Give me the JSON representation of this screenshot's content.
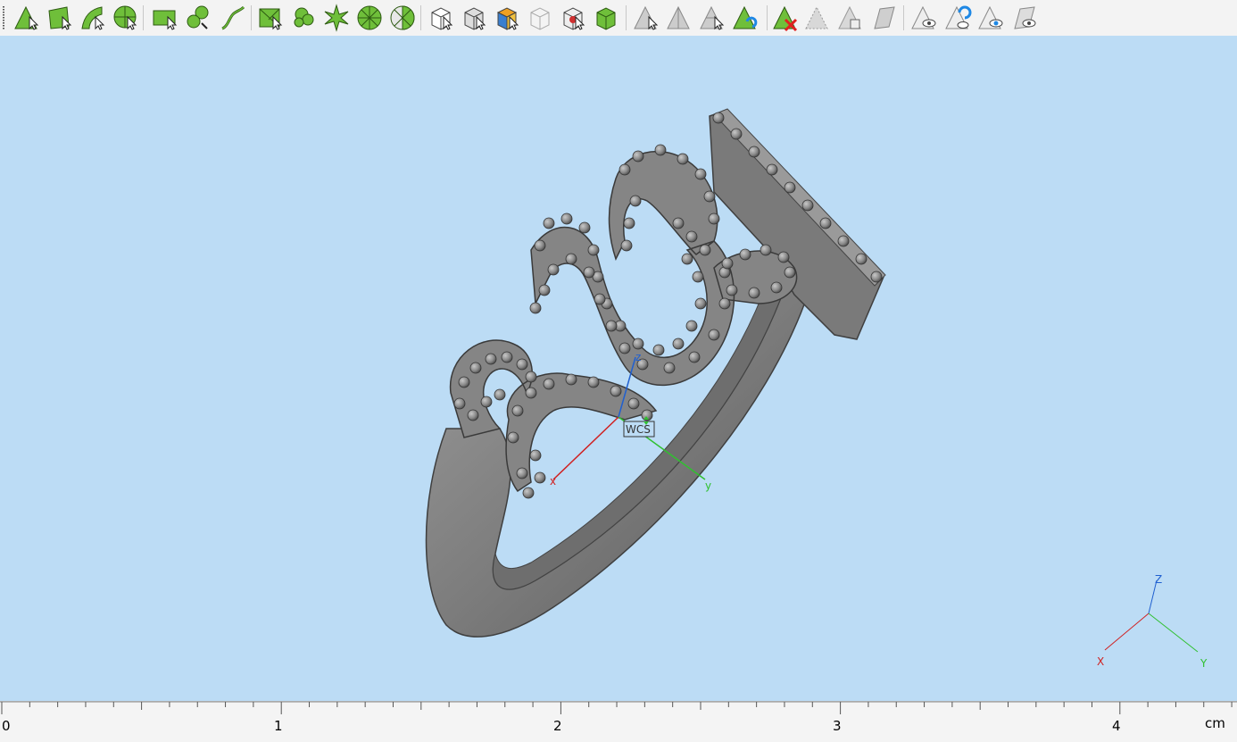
{
  "toolbar": {
    "tools": [
      {
        "name": "select-vertex-icon",
        "kind": "tri-arrow"
      },
      {
        "name": "select-face-icon",
        "kind": "quad-arrow"
      },
      {
        "name": "select-curve-icon",
        "kind": "curve-arrow"
      },
      {
        "name": "select-sphere-icon",
        "kind": "sphere-arrow"
      },
      {
        "name": "select-rectangle-icon",
        "kind": "rect-arrow"
      },
      {
        "name": "select-lasso-icon",
        "kind": "lasso"
      },
      {
        "name": "select-path-icon",
        "kind": "path"
      },
      {
        "name": "select-window-icon",
        "kind": "window"
      },
      {
        "name": "select-connected-icon",
        "kind": "blob"
      },
      {
        "name": "select-radial-icon",
        "kind": "star"
      },
      {
        "name": "select-circle-icon",
        "kind": "wheel"
      },
      {
        "name": "select-segment-icon",
        "kind": "wheel-half"
      },
      {
        "name": "select-body-icon",
        "kind": "cube-white"
      },
      {
        "name": "select-solid-icon",
        "kind": "cube-gray"
      },
      {
        "name": "select-body-face-icon",
        "kind": "cube-color"
      },
      {
        "name": "select-hidden-body-icon",
        "kind": "cube-faded"
      },
      {
        "name": "select-body-interior-icon",
        "kind": "cube-red"
      },
      {
        "name": "select-all-bodies-icon",
        "kind": "cube-green"
      },
      {
        "name": "create-triangle-icon",
        "kind": "gray-tri"
      },
      {
        "name": "extrude-triangle-icon",
        "kind": "gray-tri-cut"
      },
      {
        "name": "split-triangle-icon",
        "kind": "gray-tri-split"
      },
      {
        "name": "swap-triangle-icon",
        "kind": "tri-swap"
      },
      {
        "name": "delete-triangle-icon",
        "kind": "tri-delete"
      },
      {
        "name": "hide-triangle-icon",
        "kind": "tri-ghost"
      },
      {
        "name": "copy-triangle-icon",
        "kind": "tri-copy"
      },
      {
        "name": "flip-triangle-icon",
        "kind": "tri-flip"
      },
      {
        "name": "show-triangle-icon",
        "kind": "tri-eye"
      },
      {
        "name": "toggle-visibility-icon",
        "kind": "tri-eye-swap"
      },
      {
        "name": "show-selected-icon",
        "kind": "tri-eye-blue"
      },
      {
        "name": "show-all-icon",
        "kind": "tri-eye-gray"
      }
    ]
  },
  "viewport": {
    "wcs_label": "WCS",
    "wcs_axes": {
      "x": "x",
      "y": "y",
      "z": "z"
    },
    "corner_axes": {
      "x": "X",
      "y": "Y",
      "z": "Z"
    }
  },
  "ruler": {
    "labels": [
      "0",
      "1",
      "2",
      "3",
      "4"
    ],
    "unit": "cm"
  },
  "colors": {
    "viewport_bg": "#bcdcf5",
    "axis_x": "#d02020",
    "axis_y": "#30c030",
    "axis_z": "#2060d0",
    "tool_green": "#6fbf3a"
  }
}
